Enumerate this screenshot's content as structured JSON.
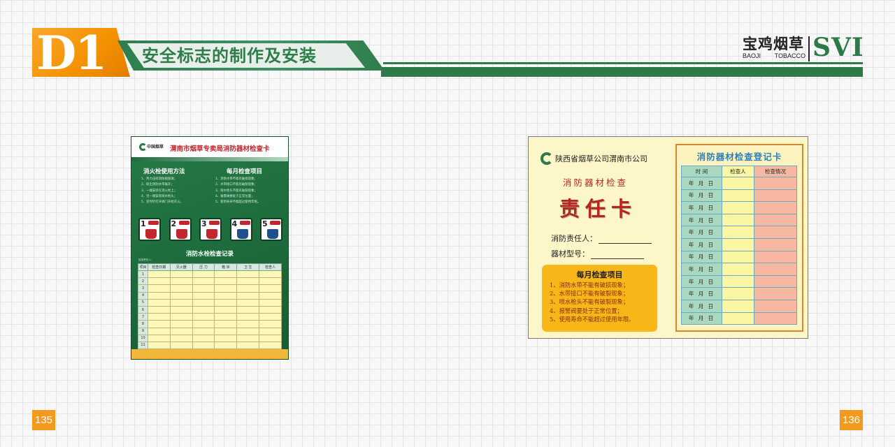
{
  "header": {
    "section_code": "D1",
    "title": "安全标志的制作及安装",
    "brand_cn": "宝鸡烟草",
    "brand_en_1": "BAOJI",
    "brand_en_2": "TOBACCO",
    "brand_svi": "SVI"
  },
  "page_numbers": {
    "left": "135",
    "right": "136"
  },
  "left_card": {
    "logo_text": "中国烟草",
    "title": "渭南市烟草专卖局消防器材检查卡",
    "section1_heading": "消火栓使用方法",
    "section1_items": [
      "1、用力击碎消防箱玻璃；",
      "2、取出消防水带展开；",
      "3、一端安装在消火栓上；",
      "4、另一端安装喷水枪头；",
      "5、逆时针打开阀门开始灭火。"
    ],
    "section2_heading": "每月检查项目",
    "section2_items": [
      "1、消防水带不能有破损现象；",
      "2、水带接口不能有破裂现象；",
      "3、喷水枪头不能有破裂现象；",
      "4、报警阀要处于正常位置；",
      "5、使用寿命不能超过使用年限。"
    ],
    "steps": [
      "1",
      "2",
      "3",
      "4",
      "5"
    ],
    "record_title": "消防水栓检查记录",
    "record_note": "检查责任人：",
    "table_headers": [
      "项目",
      "检查日期",
      "灭火器",
      "压  力",
      "箱  体",
      "卫  生",
      "检查人"
    ],
    "table_row_label": "月份",
    "table_rows": [
      "1",
      "2",
      "3",
      "4",
      "5",
      "6",
      "7",
      "8",
      "9",
      "10",
      "11",
      "12"
    ]
  },
  "right_card": {
    "company": "陕西省烟草公司渭南市公司",
    "subtitle": "消防器材检查",
    "big_title": "责任卡",
    "field_1": "消防责任人：",
    "field_2": "器材型号：",
    "monthly_heading": "每月检查项目",
    "monthly_items": [
      "1、消防水带不能有破损现象；",
      "2、水带接口不能有破裂现象；",
      "3、喷水枪头不能有破裂现象；",
      "4、报警阀要处于正常位置；",
      "5、使用寿命不能超过使用年限。"
    ],
    "register_title": "消防器材检查登记卡",
    "register_headers": [
      "时  间",
      "检查人",
      "检查情况"
    ],
    "register_date_text": "年 月 日",
    "register_row_count": 12
  },
  "colors": {
    "brand_green": "#2c7a48",
    "accent_orange": "#f39200",
    "card_red": "#b5261e",
    "register_blue": "#2d7fb8"
  }
}
